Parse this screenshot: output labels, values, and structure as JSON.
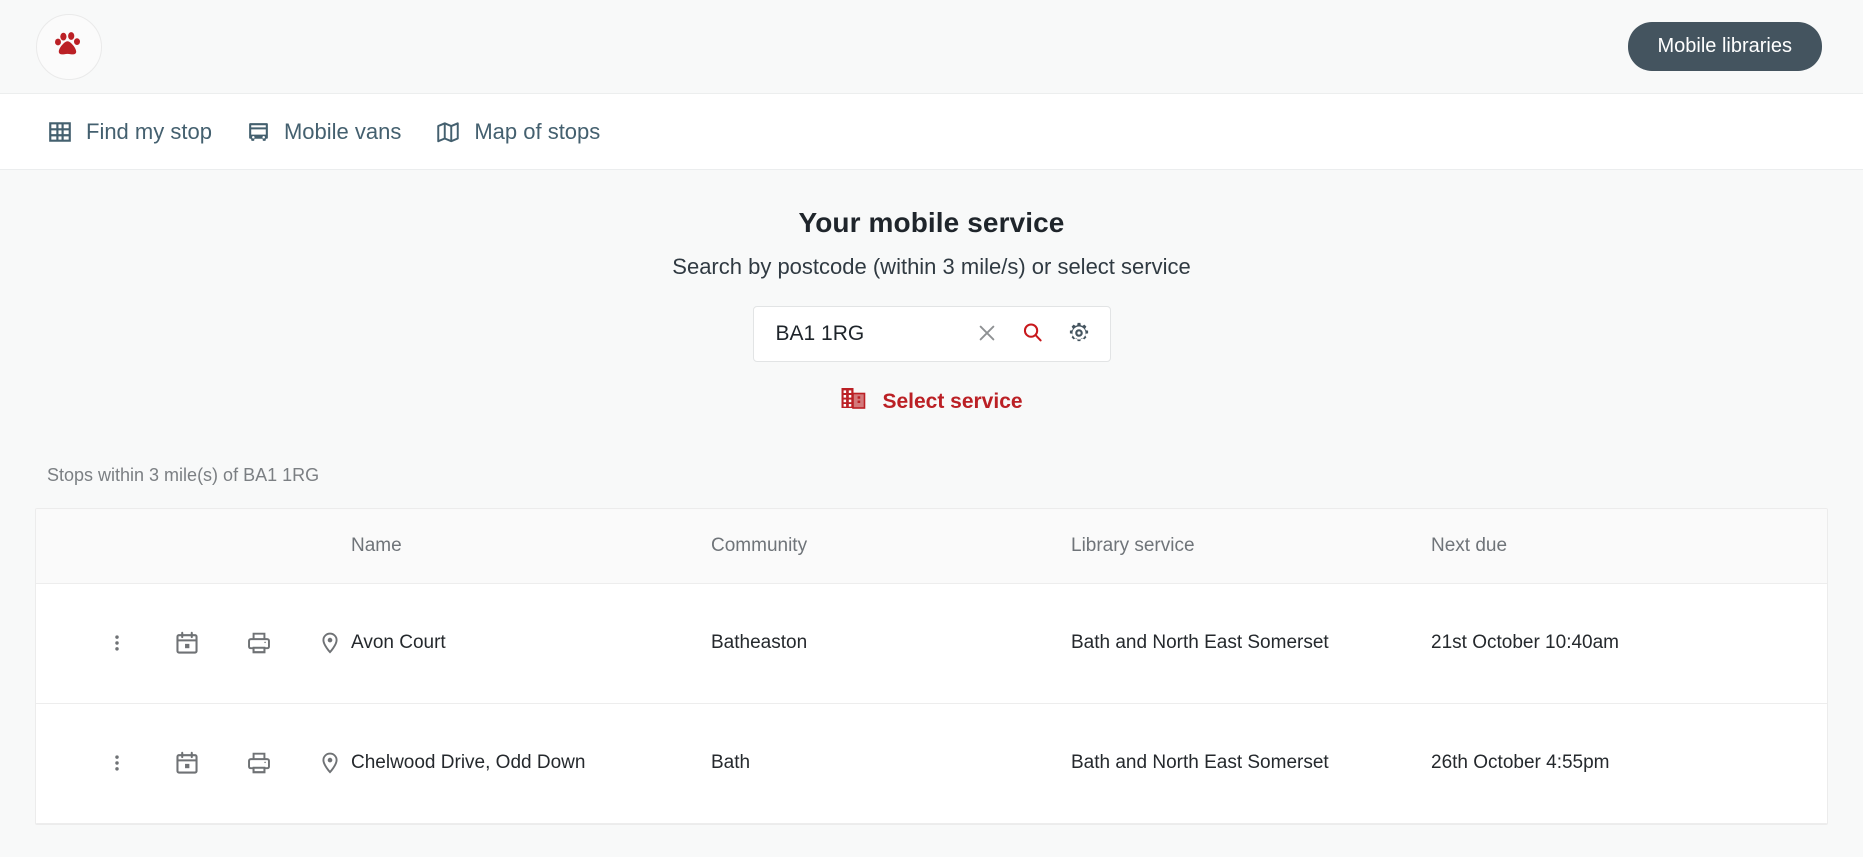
{
  "header": {
    "logo_icon": "paw-print-icon",
    "brand_button_label": "Mobile libraries"
  },
  "nav": {
    "items": [
      {
        "label": "Find my stop",
        "icon": "grid-icon"
      },
      {
        "label": "Mobile vans",
        "icon": "bus-icon"
      },
      {
        "label": "Map of stops",
        "icon": "map-icon"
      }
    ]
  },
  "main": {
    "title": "Your mobile service",
    "subtitle": "Search by postcode (within 3 mile/s) or select service",
    "search": {
      "value": "BA1 1RG",
      "placeholder": "Enter postcode",
      "clear_icon": "close-icon",
      "search_icon": "search-icon",
      "settings_icon": "gear-icon"
    },
    "select_service": {
      "label": "Select service",
      "icon": "building-icon"
    },
    "results_caption": "Stops within 3 mile(s) of BA1 1RG"
  },
  "table": {
    "columns": [
      "",
      "Name",
      "Community",
      "Library service",
      "Next due"
    ],
    "row_icons": [
      "more-vertical-icon",
      "calendar-icon",
      "print-icon",
      "location-pin-icon"
    ],
    "rows": [
      {
        "name": "Avon Court",
        "community": "Batheaston",
        "library_service": "Bath and North East Somerset",
        "next_due": "21st October 10:40am"
      },
      {
        "name": "Chelwood Drive, Odd Down",
        "community": "Bath",
        "library_service": "Bath and North East Somerset",
        "next_due": "26th October 4:55pm"
      }
    ]
  },
  "colors": {
    "accent_red": "#bb2025",
    "slate": "#44606f",
    "brand_button_bg": "#44545f",
    "page_bg": "#f8f9f9"
  }
}
